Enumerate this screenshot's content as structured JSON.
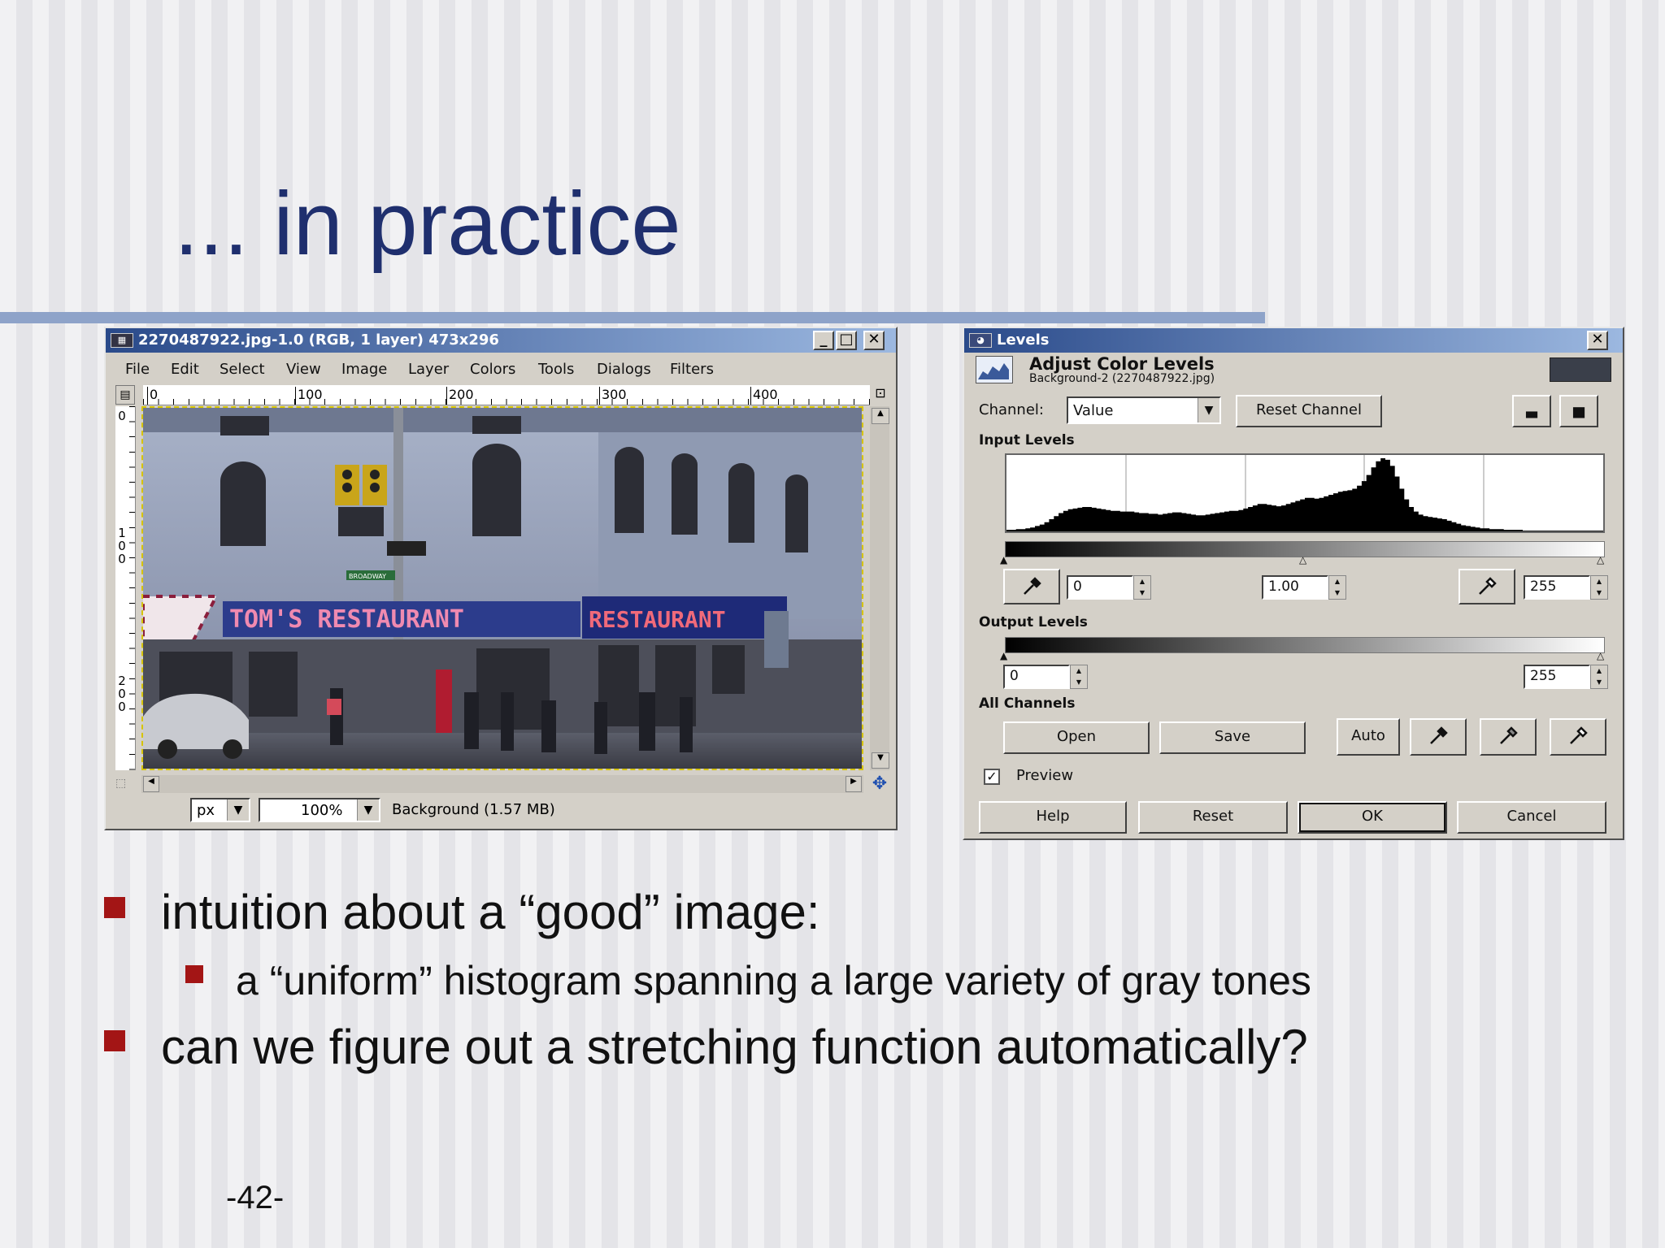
{
  "slide": {
    "title": "... in practice",
    "page_number": "-42-"
  },
  "gimp_window": {
    "title": "2270487922.jpg-1.0 (RGB, 1 layer) 473x296",
    "menu": [
      "File",
      "Edit",
      "Select",
      "View",
      "Image",
      "Layer",
      "Colors",
      "Tools",
      "Dialogs",
      "Filters"
    ],
    "ruler_h": [
      "0",
      "100",
      "200",
      "300",
      "400"
    ],
    "ruler_v": [
      "0",
      "100",
      "200"
    ],
    "unit": "px",
    "zoom": "100%",
    "status": "Background (1.57 MB)",
    "photo": {
      "sign_left": "TOM'S RESTAURANT",
      "sign_right": "RESTAURANT",
      "street_sign": "BROADWAY"
    }
  },
  "levels_dialog": {
    "title": "Levels",
    "heading": "Adjust Color Levels",
    "subheading": "Background-2 (2270487922.jpg)",
    "channel_label": "Channel:",
    "channel_value": "Value",
    "reset_channel": "Reset Channel",
    "input_levels_label": "Input Levels",
    "input_low": "0",
    "input_gamma": "1.00",
    "input_high": "255",
    "output_levels_label": "Output Levels",
    "output_low": "0",
    "output_high": "255",
    "all_channels_label": "All Channels",
    "open": "Open",
    "save": "Save",
    "auto": "Auto",
    "preview": "Preview",
    "preview_checked": true,
    "help": "Help",
    "reset": "Reset",
    "ok": "OK",
    "cancel": "Cancel",
    "histogram": [
      2,
      2,
      3,
      3,
      4,
      5,
      7,
      9,
      12,
      16,
      20,
      24,
      27,
      29,
      30,
      31,
      32,
      32,
      31,
      30,
      29,
      28,
      27,
      27,
      26,
      26,
      26,
      25,
      24,
      24,
      23,
      23,
      22,
      23,
      24,
      25,
      25,
      24,
      23,
      22,
      21,
      21,
      22,
      23,
      24,
      25,
      26,
      27,
      27,
      28,
      30,
      32,
      34,
      36,
      36,
      35,
      34,
      33,
      34,
      36,
      38,
      40,
      42,
      44,
      44,
      43,
      44,
      46,
      48,
      50,
      52,
      53,
      54,
      56,
      60,
      66,
      74,
      84,
      92,
      96,
      94,
      86,
      72,
      56,
      42,
      32,
      26,
      22,
      20,
      19,
      18,
      17,
      16,
      14,
      12,
      10,
      8,
      7,
      6,
      5,
      4,
      4,
      3,
      3,
      3,
      2,
      2,
      2,
      2,
      1,
      1,
      1,
      1,
      1,
      1,
      1,
      1,
      1,
      1,
      1,
      1,
      1,
      1,
      1,
      1,
      1
    ]
  },
  "bullets": [
    {
      "level": 1,
      "text": "intuition about a “good” image:"
    },
    {
      "level": 2,
      "text": "a “uniform” histogram spanning a large variety of gray tones"
    },
    {
      "level": 1,
      "text": "can we figure out a stretching function automatically?"
    }
  ],
  "colors": {
    "title": "#1f2f6e",
    "bullet": "#a31515",
    "rule": "#8ea3c9"
  }
}
